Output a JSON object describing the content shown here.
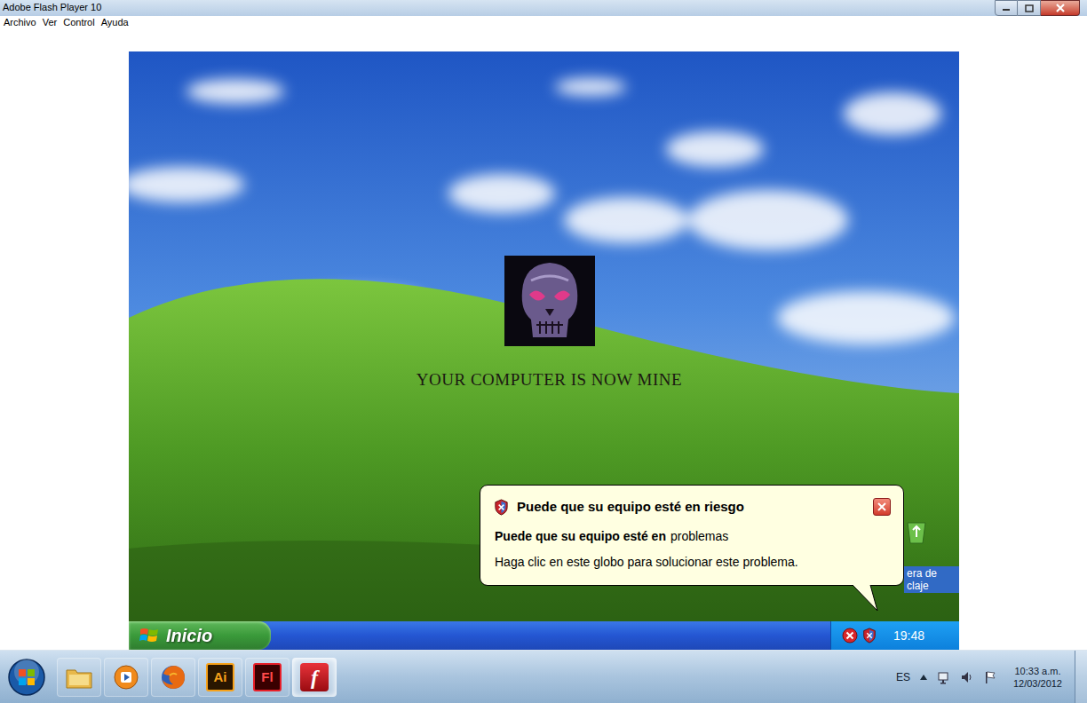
{
  "window": {
    "title": "Adobe Flash Player 10"
  },
  "menu": [
    {
      "label": "Archivo"
    },
    {
      "label": "Ver"
    },
    {
      "label": "Control"
    },
    {
      "label": "Ayuda"
    }
  ],
  "stage": {
    "message": "YOUR COMPUTER IS NOW MINE",
    "desktop_icon": {
      "label_lines": [
        "era de",
        "claje"
      ],
      "selected": true
    },
    "balloon": {
      "title": "Puede que su equipo esté en riesgo",
      "heading_bold": "Puede que su equipo esté en",
      "heading_rest": "problemas",
      "body": "Haga clic en este globo para solucionar este problema."
    },
    "taskbar": {
      "start": "Inicio",
      "clock": "19:48"
    }
  },
  "os_taskbar": {
    "pinned": [
      {
        "kind": "explorer",
        "active": false
      },
      {
        "kind": "media",
        "active": false
      },
      {
        "kind": "firefox",
        "active": false
      },
      {
        "kind": "illustrator",
        "label": "Ai",
        "active": false
      },
      {
        "kind": "flash",
        "label": "Fl",
        "active": false
      },
      {
        "kind": "flashplayer",
        "label": "f",
        "active": true
      }
    ],
    "language": "ES",
    "time": "10:33 a.m.",
    "date": "12/03/2012"
  }
}
